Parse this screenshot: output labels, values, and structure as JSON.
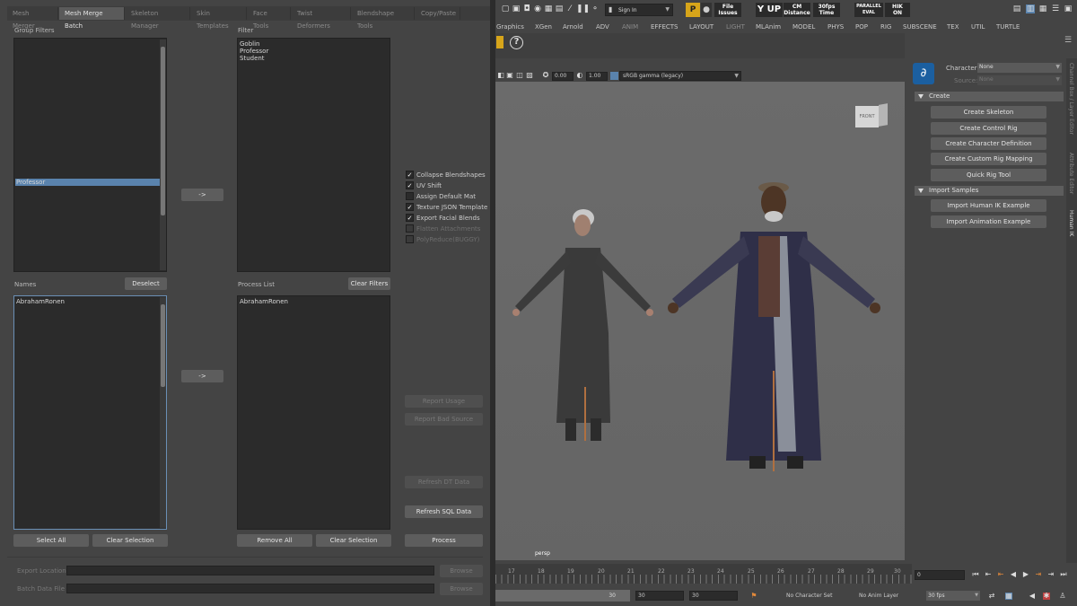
{
  "left_tabs": [
    "Mesh Merger",
    "Mesh Merge Batch",
    "Skeleton Manager",
    "Skin Templates",
    "Face Tools",
    "Twist Deformers",
    "Blendshape Tools",
    "Copy/Paste"
  ],
  "group_filters": {
    "label": "Group Filters",
    "selected": "Professor"
  },
  "filter": {
    "label": "Filter",
    "items_text": "Goblin\nProfessor\nStudent"
  },
  "names": {
    "label": "Names",
    "deselect": "Deselect",
    "items": [
      "AbrahamRonen"
    ]
  },
  "process_list": {
    "label": "Process List",
    "clear_filters": "Clear Filters",
    "items": [
      "AbrahamRonen"
    ]
  },
  "arrow": "->",
  "options": [
    {
      "label": "Collapse Blendshapes",
      "checked": true,
      "enabled": true
    },
    {
      "label": "UV Shift",
      "checked": true,
      "enabled": true
    },
    {
      "label": "Assign Default Mat",
      "checked": false,
      "enabled": true
    },
    {
      "label": "Texture JSON Template",
      "checked": true,
      "enabled": true
    },
    {
      "label": "Export Facial Blends",
      "checked": true,
      "enabled": true
    },
    {
      "label": "Flatten Attachments",
      "checked": false,
      "enabled": false
    },
    {
      "label": "PolyReduce(BUGGY)",
      "checked": false,
      "enabled": false
    }
  ],
  "right_buttons": {
    "report_usage": "Report Usage",
    "report_bad_source": "Report Bad Source",
    "refresh_dt": "Refresh DT Data",
    "refresh_sql": "Refresh SQL Data",
    "process": "Process"
  },
  "bottom_buttons": {
    "select_all": "Select All",
    "clear_selection_1": "Clear Selection",
    "remove_all": "Remove All",
    "clear_selection_2": "Clear Selection"
  },
  "export_location": {
    "label": "Export Location",
    "browse": "Browse"
  },
  "batch_data_file": {
    "label": "Batch Data File",
    "browse": "Browse"
  },
  "top_toolbar": {
    "sign_in": "Sign In",
    "file_issues_1": "File",
    "file_issues_2": "Issues",
    "yup": "Y UP",
    "cm_1": "CM",
    "cm_2": "Distance",
    "fps_1": "30fps",
    "fps_2": "Time",
    "parallel_1": "PARALLEL",
    "parallel_2": "EVAL",
    "hik_1": "HIK",
    "hik_2": "ON"
  },
  "shelf_tabs": [
    "Graphics",
    "XGen",
    "Arnold",
    "ADV",
    "ANIM",
    "EFFECTS",
    "LAYOUT",
    "LIGHT",
    "MLAnim",
    "MODEL",
    "PHYS",
    "POP",
    "RIG",
    "SUBSCENE",
    "TEX",
    "UTIL",
    "TURTLE"
  ],
  "viewport": {
    "exposure": "0.00",
    "gamma": "1.00",
    "color_space": "sRGB gamma (legacy)",
    "camera": "persp",
    "view_cube": "FRONT"
  },
  "hik": {
    "character_label": "Character:",
    "character_value": "None",
    "source_label": "Source:",
    "source_value": "None",
    "create_header": "Create",
    "create_buttons": [
      "Create Skeleton",
      "Create Control Rig",
      "Create Character Definition",
      "Create Custom Rig Mapping",
      "Quick Rig Tool"
    ],
    "import_header": "Import Samples",
    "import_buttons": [
      "Import Human IK Example",
      "Import Animation Example"
    ]
  },
  "side_tabs": [
    "Channel Box / Layer Editor",
    "Attribute Editor",
    "Human IK"
  ],
  "timeline": {
    "ticks": [
      "17",
      "18",
      "19",
      "20",
      "21",
      "22",
      "23",
      "24",
      "25",
      "26",
      "27",
      "28",
      "29",
      "30"
    ],
    "current_frame": "0",
    "range_start_field": "30",
    "range_end_1": "30",
    "range_end_2": "30",
    "character_set": "No Character Set",
    "anim_layer": "No Anim Layer",
    "fps": "30 fps"
  }
}
